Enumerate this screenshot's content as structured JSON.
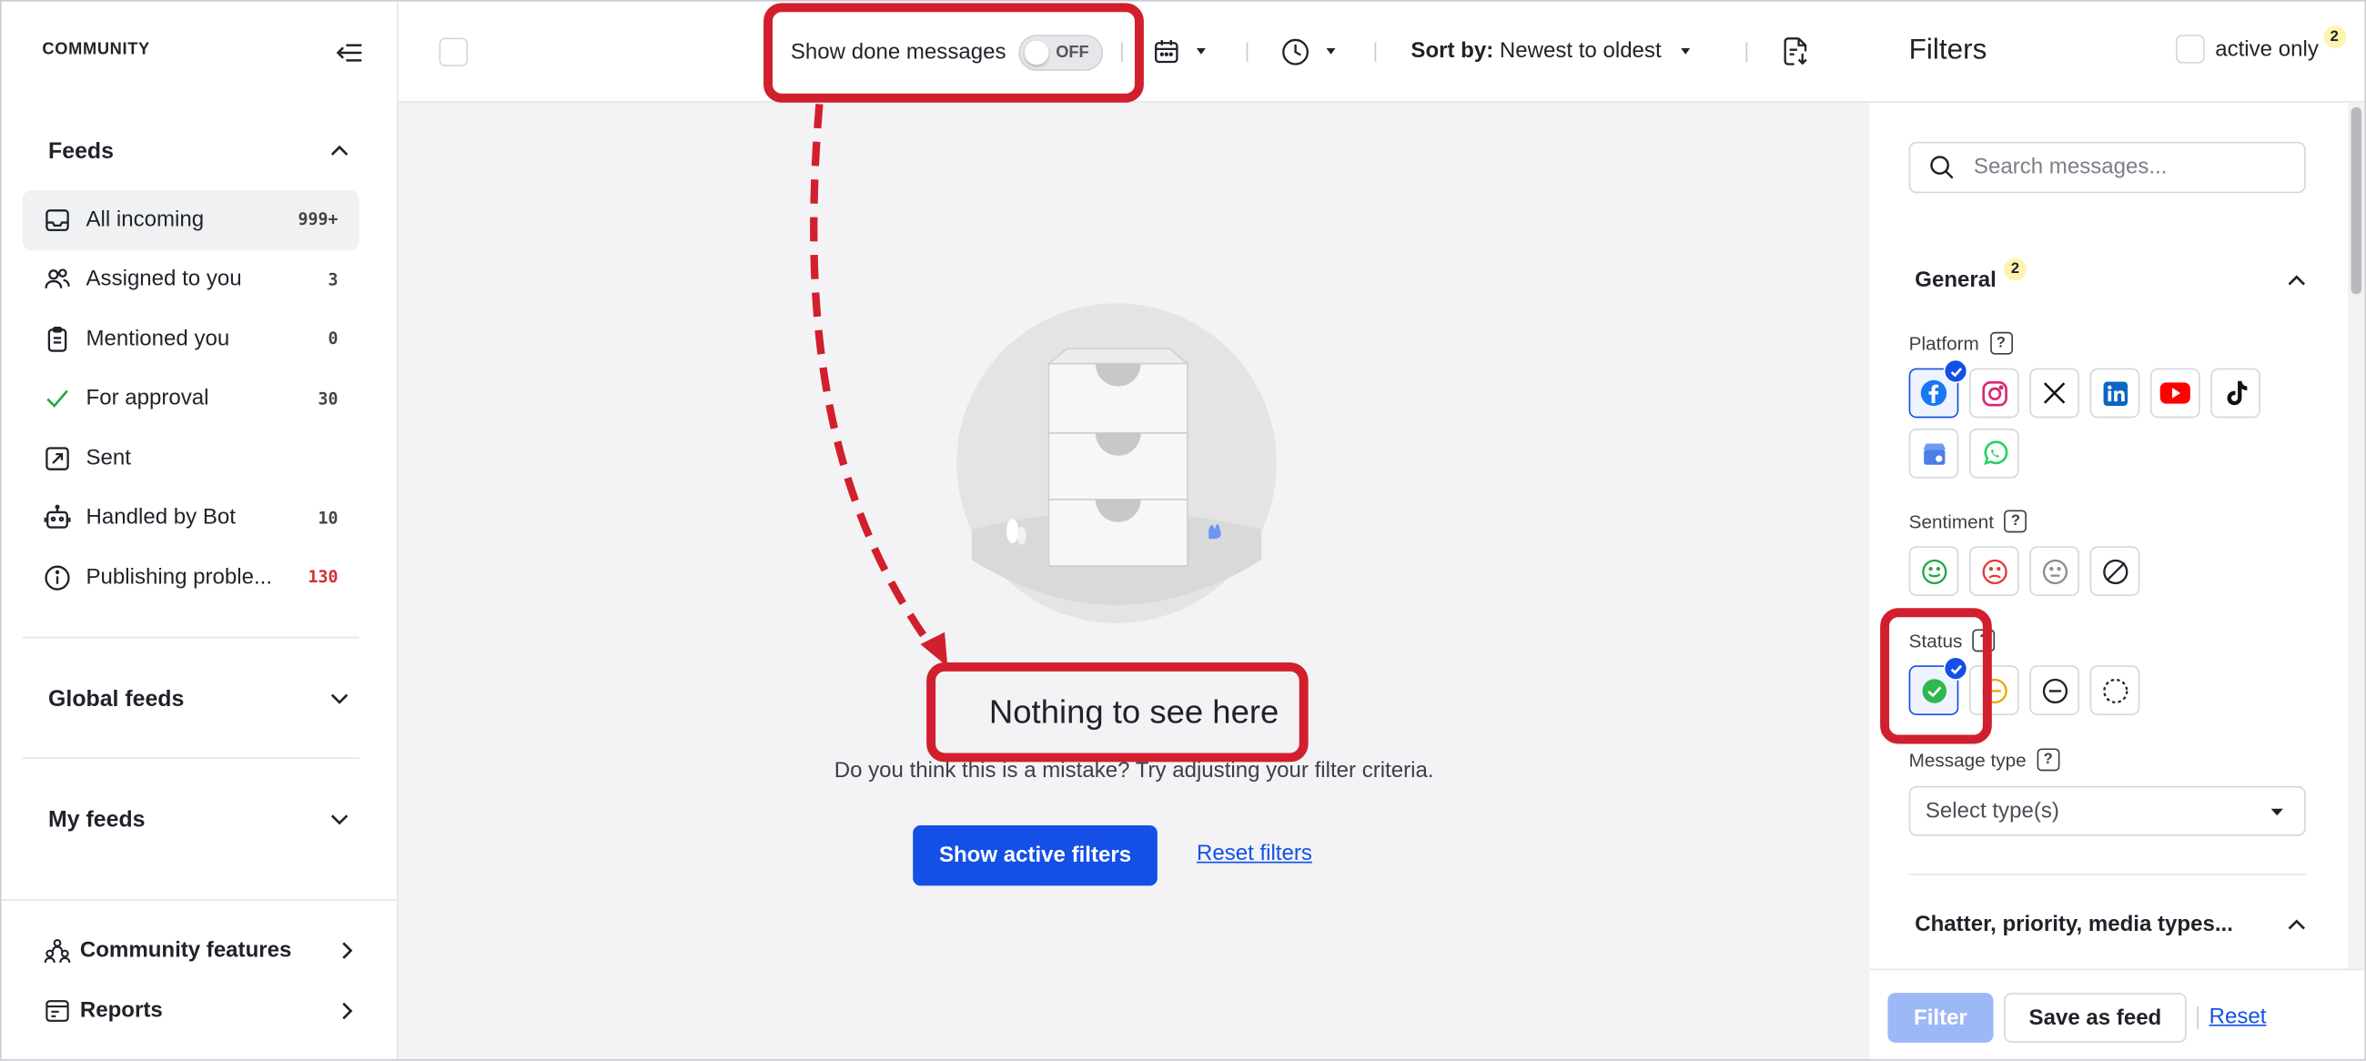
{
  "sidebar": {
    "brand": "COMMUNITY",
    "feeds_title": "Feeds",
    "items": [
      {
        "label": "All incoming",
        "count": "999+"
      },
      {
        "label": "Assigned to you",
        "count": "3"
      },
      {
        "label": "Mentioned you",
        "count": "0"
      },
      {
        "label": "For approval",
        "count": "30"
      },
      {
        "label": "Sent",
        "count": ""
      },
      {
        "label": "Handled by Bot",
        "count": "10"
      },
      {
        "label": "Publishing proble...",
        "count": "130"
      }
    ],
    "global_feeds": "Global feeds",
    "my_feeds": "My feeds",
    "community_features": "Community features",
    "reports": "Reports"
  },
  "toolbar": {
    "show_done_label": "Show done messages",
    "toggle_state": "OFF",
    "sort_prefix": "Sort by:",
    "sort_value": "Newest to oldest"
  },
  "empty": {
    "title": "Nothing to see here",
    "subtitle": "Do you think this is a mistake? Try adjusting your filter criteria.",
    "show_filters": "Show active filters",
    "reset": "Reset filters"
  },
  "filters": {
    "title": "Filters",
    "active_only": "active only",
    "active_count": "2",
    "search_placeholder": "Search messages...",
    "general": "General",
    "general_count": "2",
    "platform_label": "Platform",
    "sentiment_label": "Sentiment",
    "status_label": "Status",
    "message_type_label": "Message type",
    "message_type_placeholder": "Select type(s)",
    "chatter_group": "Chatter, priority, media types...",
    "filter_btn": "Filter",
    "save_btn": "Save as feed",
    "reset_btn": "Reset",
    "help_glyph": "?"
  },
  "colors": {
    "accent": "#1450e6",
    "annotation": "#d11f2e",
    "badge": "#fff3b0"
  }
}
